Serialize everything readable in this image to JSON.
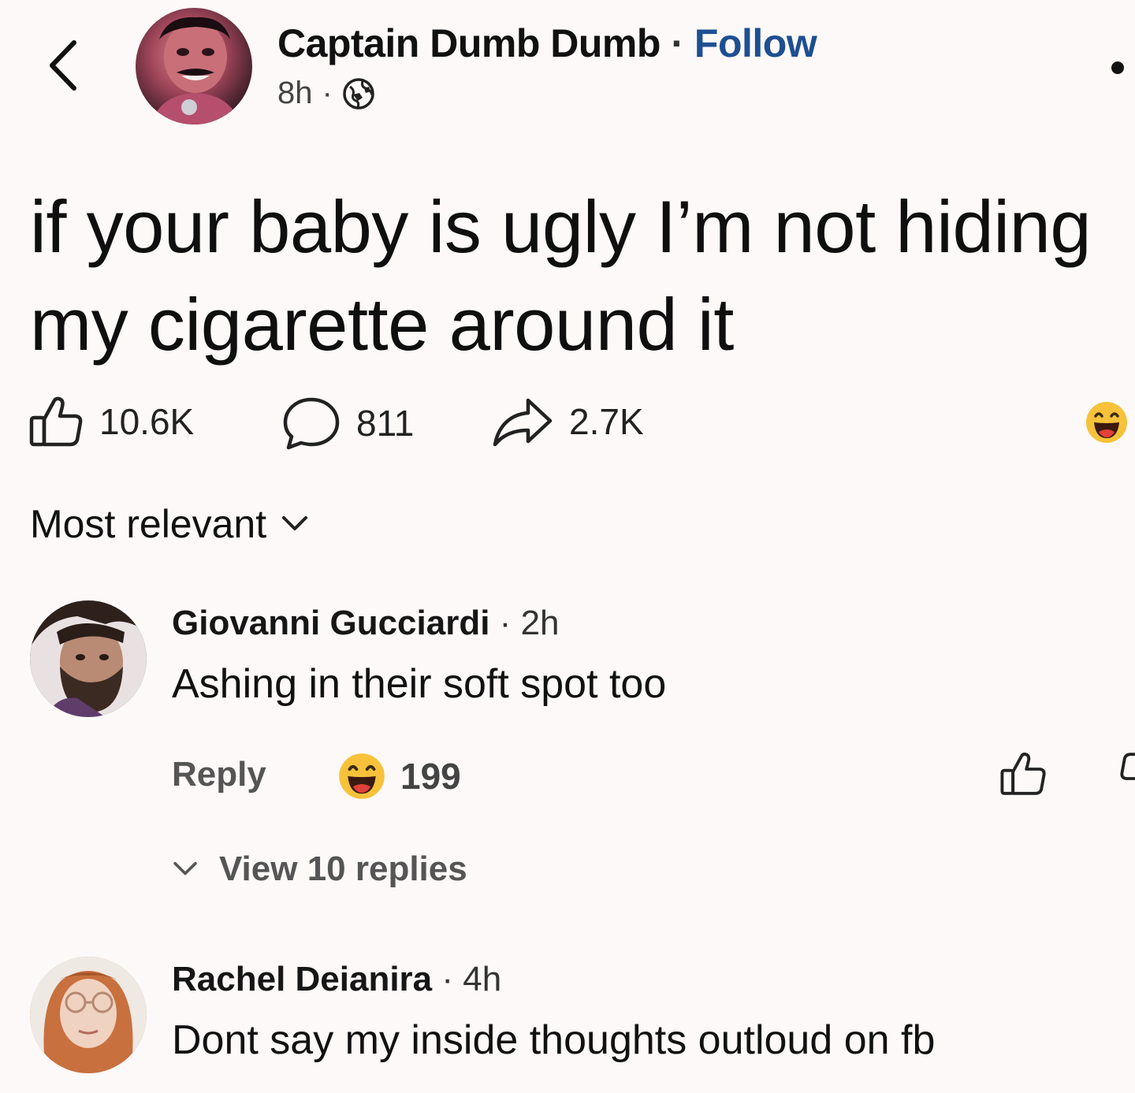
{
  "post": {
    "author": "Captain Dumb Dumb",
    "separator": "·",
    "follow_label": "Follow",
    "time": "8h",
    "meta_separator": "·",
    "text": "if your baby is ugly I’m not hiding my cigarette around it",
    "stats": {
      "likes": "10.6K",
      "comments": "811",
      "shares": "2.7K"
    }
  },
  "sort": {
    "label": "Most relevant"
  },
  "comments": [
    {
      "author": "Giovanni Gucciardi",
      "time": "2h",
      "separator": "·",
      "text": "Ashing in their soft spot too",
      "reply_label": "Reply",
      "reaction_count": "199",
      "view_replies_label": "View 10 replies"
    },
    {
      "author": "Rachel Deianira",
      "time": "4h",
      "separator": "·",
      "text": "Dont say my inside thoughts outloud on fb"
    }
  ],
  "colors": {
    "background": "#fcf9f8",
    "follow_link": "#1d4f91",
    "emoji_yellow": "#f7c23a",
    "emoji_mouth": "#e0413a"
  },
  "icons": {
    "back": "chevron-left-icon",
    "globe": "globe-icon",
    "more": "more-icon",
    "like": "thumbs-up-icon",
    "comment": "comment-bubble-icon",
    "share": "share-arrow-icon",
    "reaction": "haha-emoji-icon",
    "sort": "chevron-down-icon"
  }
}
